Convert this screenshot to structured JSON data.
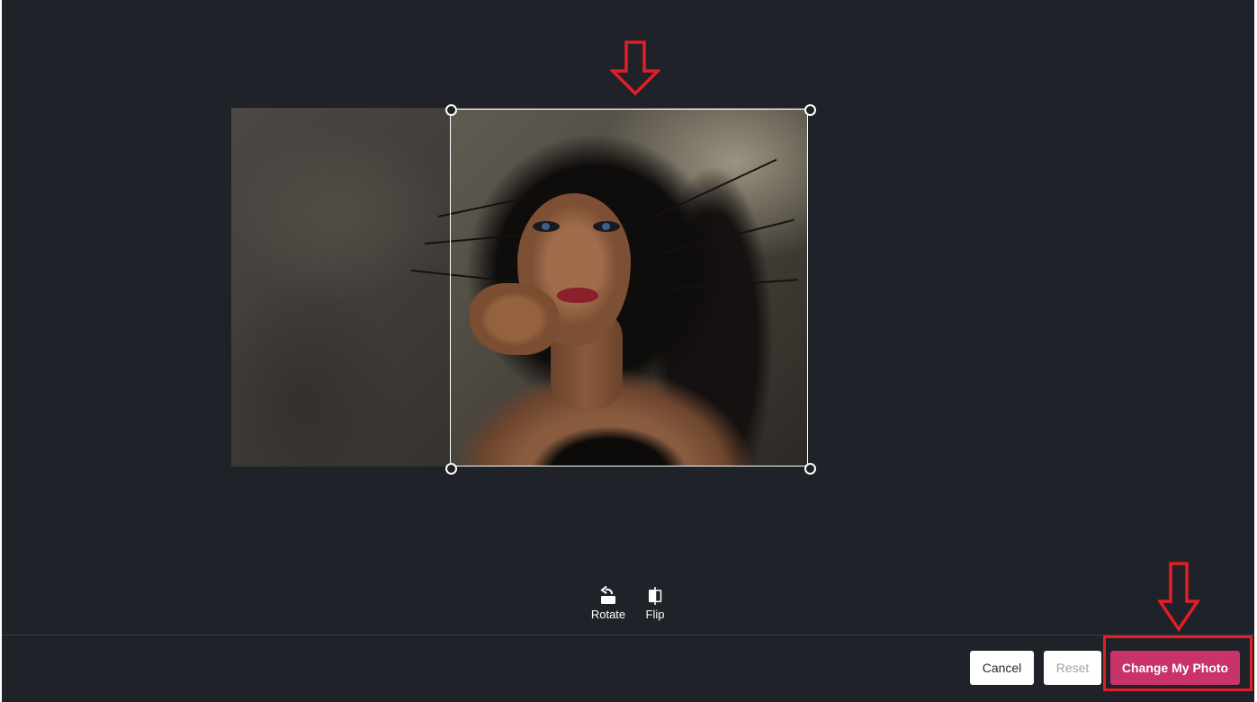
{
  "tools": {
    "rotate_label": "Rotate",
    "flip_label": "Flip"
  },
  "actions": {
    "cancel_label": "Cancel",
    "reset_label": "Reset",
    "change_label": "Change My Photo"
  },
  "icons": {
    "rotate": "rotate-left-icon",
    "flip": "flip-horizontal-icon",
    "annotation_arrow": "down-arrow-icon"
  },
  "colors": {
    "background": "#1f2228",
    "primary_button": "#c8336a",
    "annotation": "#e21e26"
  }
}
